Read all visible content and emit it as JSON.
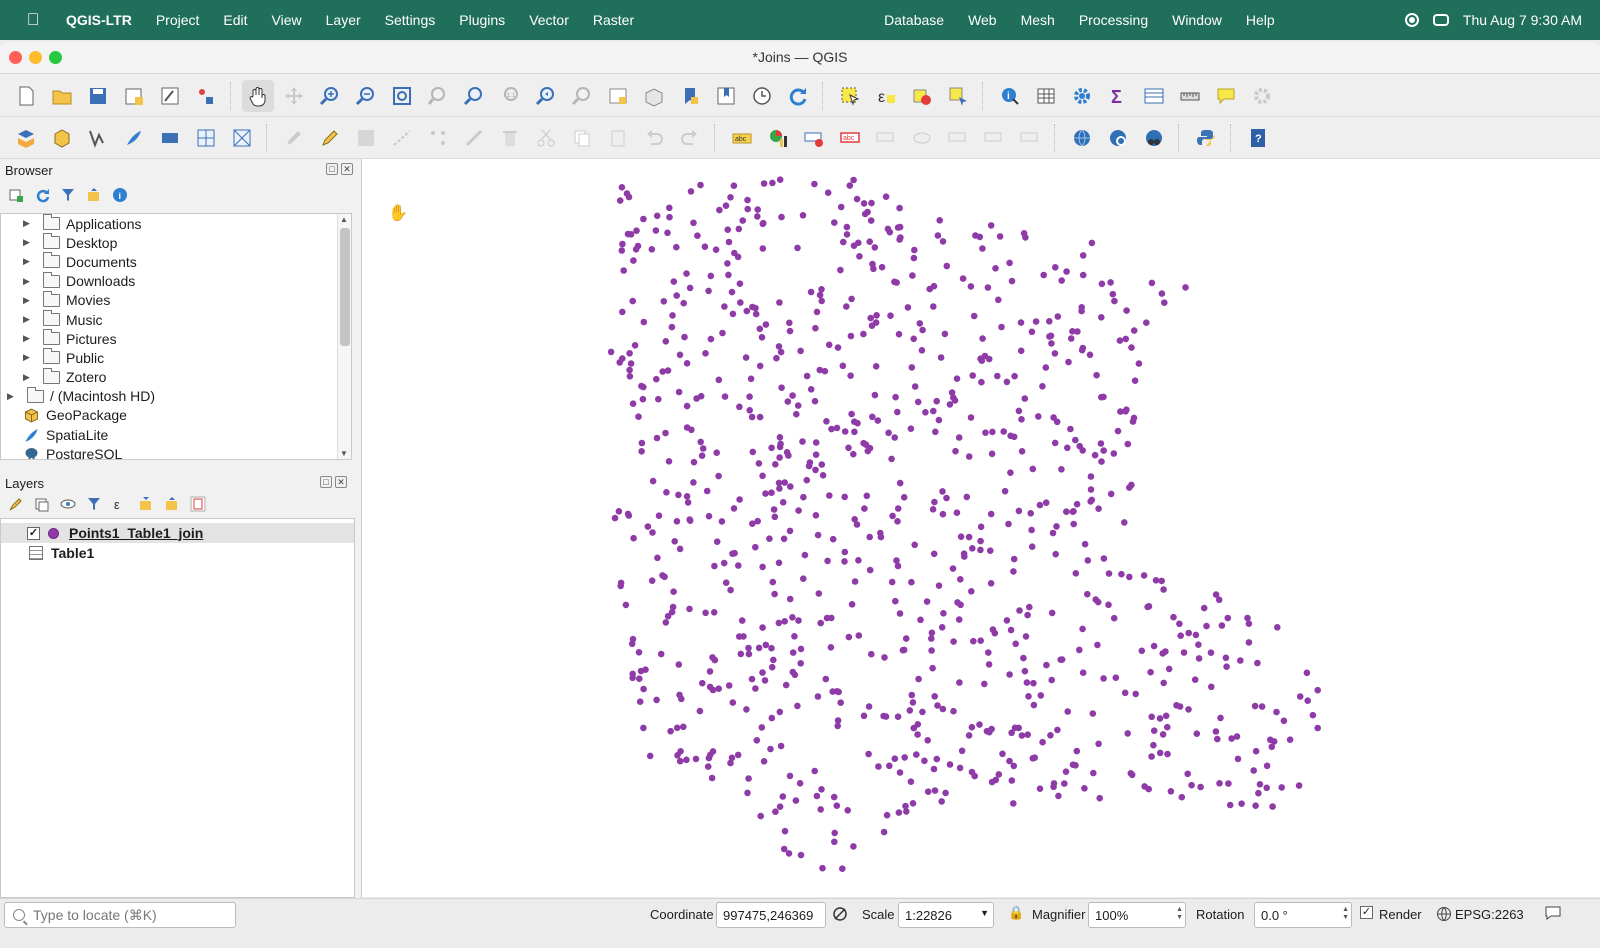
{
  "menubar": {
    "app_name": "QGIS-LTR",
    "menus_left": [
      "Project",
      "Edit",
      "View",
      "Layer",
      "Settings",
      "Plugins",
      "Vector",
      "Raster"
    ],
    "menus_right": [
      "Database",
      "Web",
      "Mesh",
      "Processing",
      "Window",
      "Help"
    ],
    "datetime": "Thu Aug 7  9:30 AM"
  },
  "window": {
    "title": "*Joins — QGIS"
  },
  "browser": {
    "title": "Browser",
    "items": [
      {
        "label": "Applications",
        "type": "folder"
      },
      {
        "label": "Desktop",
        "type": "folder"
      },
      {
        "label": "Documents",
        "type": "folder"
      },
      {
        "label": "Downloads",
        "type": "folder"
      },
      {
        "label": "Movies",
        "type": "folder"
      },
      {
        "label": "Music",
        "type": "folder"
      },
      {
        "label": "Pictures",
        "type": "folder"
      },
      {
        "label": "Public",
        "type": "folder"
      },
      {
        "label": "Zotero",
        "type": "folder"
      },
      {
        "label": "/ (Macintosh HD)",
        "type": "drive"
      },
      {
        "label": "GeoPackage",
        "type": "geopackage"
      },
      {
        "label": "SpatiaLite",
        "type": "spatialite"
      },
      {
        "label": "PostgreSQL",
        "type": "postgresql"
      }
    ]
  },
  "layers": {
    "title": "Layers",
    "items": [
      {
        "name": "Points1_Table1_join",
        "checked": true,
        "selected": true,
        "symbol_color": "#8e3ba8"
      },
      {
        "name": "Table1",
        "type": "table"
      }
    ]
  },
  "statusbar": {
    "locate_placeholder": "Type to locate (⌘K)",
    "coordinate_label": "Coordinate",
    "coordinate": "997475,246369",
    "scale_label": "Scale",
    "scale": "1:22826",
    "magnifier_label": "Magnifier",
    "magnifier": "100%",
    "rotation_label": "Rotation",
    "rotation": "0.0 °",
    "render_label": "Render",
    "render_checked": true,
    "crs": "EPSG:2263"
  },
  "colors": {
    "menubar": "#1f6f5a",
    "point": "#8e3ba8"
  }
}
